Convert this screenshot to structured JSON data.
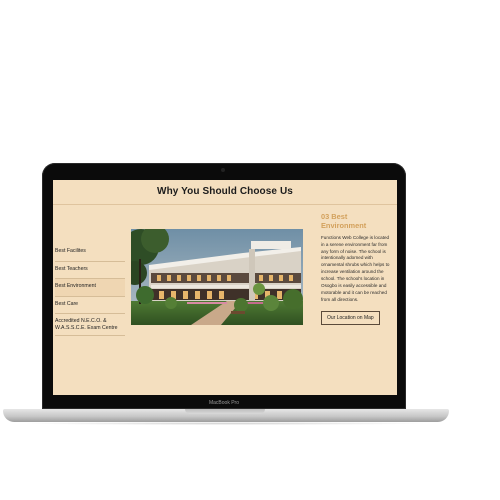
{
  "page": {
    "title": "Why You Should Choose Us"
  },
  "tabs": [
    {
      "label": "Best Facilites"
    },
    {
      "label": "Best Teachers"
    },
    {
      "label": "Best Environment"
    },
    {
      "label": "Best Care"
    },
    {
      "label": "Accredited N.E.C.O. & W.A.S.S.C.E. Exam Centre"
    }
  ],
  "active_tab": "Best Environment",
  "detail": {
    "title": "03 Best Environment",
    "body": "Functions Web College is located in a serene environment far from any form of noise. The school is intentionally adorned with ornamental shrubs which helps to increase ventilation around the school. The school's location in Osogbo is easily accessible and motorable and it can be reached from all directions.",
    "button_label": "Our Location on Map"
  },
  "device": {
    "label": "MacBook Pro"
  },
  "colors": {
    "screen_bg": "#f4dfbf",
    "accent": "#d3a15c",
    "bezel": "#0b0b0b"
  }
}
